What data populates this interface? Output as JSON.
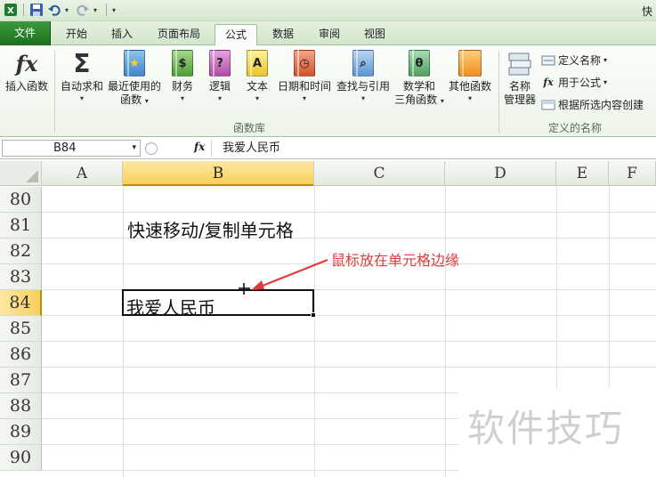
{
  "window": {
    "title_fragment": "快"
  },
  "qat": {
    "items": [
      "save-icon",
      "undo-icon",
      "redo-icon",
      "customize-icon"
    ]
  },
  "tabs": [
    {
      "label": "文件"
    },
    {
      "label": "开始"
    },
    {
      "label": "插入"
    },
    {
      "label": "页面布局"
    },
    {
      "label": "公式"
    },
    {
      "label": "数据"
    },
    {
      "label": "审阅"
    },
    {
      "label": "视图"
    }
  ],
  "ribbon": {
    "insert_function": "插入函数",
    "autosum": "自动求和",
    "recent_1": "最近使用的",
    "recent_2": "函数",
    "financial": "财务",
    "logical": "逻辑",
    "text": "文本",
    "datetime": "日期和时间",
    "lookup": "查找与引用",
    "math_1": "数学和",
    "math_2": "三角函数",
    "other": "其他函数",
    "group_library": "函数库",
    "name_manager_1": "名称",
    "name_manager_2": "管理器",
    "define_name": "定义名称",
    "use_in_formula": "用于公式",
    "create_from_selection": "根据所选内容创建",
    "group_defined_names": "定义的名称"
  },
  "formula_bar": {
    "name_box": "B84",
    "fx_symbol": "fx",
    "content": "我爱人民币"
  },
  "columns": [
    "A",
    "B",
    "C",
    "D",
    "E",
    "F"
  ],
  "rows": [
    "80",
    "81",
    "82",
    "83",
    "84",
    "85",
    "86",
    "87",
    "88",
    "89",
    "90"
  ],
  "cells": {
    "b81": "快速移动/复制单元格",
    "b84": "我爱人民币"
  },
  "annotation": "鼠标放在单元格边缘",
  "watermark": "软件技巧",
  "colors": {
    "accent": "#1d6f1d",
    "selected_header": "#f8cf5b",
    "annotation": "#e03a3a"
  }
}
